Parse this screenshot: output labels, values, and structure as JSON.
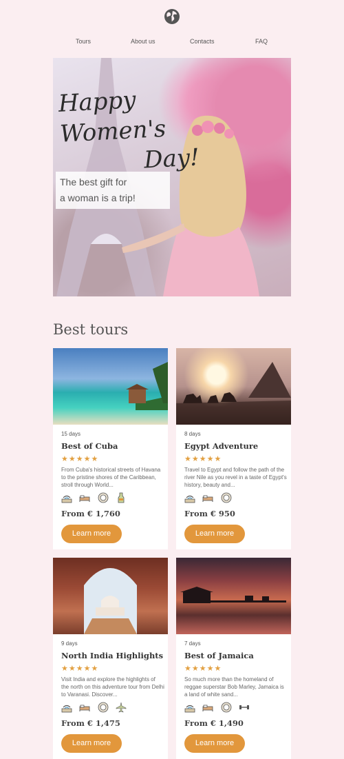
{
  "header": {
    "logo_icon": "globe-icon",
    "nav": [
      "Tours",
      "About us",
      "Contacts",
      "FAQ"
    ]
  },
  "hero": {
    "title_line1": "Happy Women's",
    "title_line2": "Day!",
    "caption_line1": "The best gift for",
    "caption_line2": "a woman is a trip!"
  },
  "section_title": "Best tours",
  "tours": [
    {
      "days": "15 days",
      "name": "Best of Cuba",
      "stars": "★★★★★",
      "desc": "From Cuba's historical streets of Havana to the pristine shores of the Caribbean, stroll through World...",
      "icons": [
        "wifi-icon",
        "bed-icon",
        "meal-icon",
        "drink-icon"
      ],
      "price": "From € 1,760",
      "button": "Learn more"
    },
    {
      "days": "8 days",
      "name": "Egypt Adventure",
      "stars": "★★★★★",
      "desc": "Travel to Egypt and follow the path of the river Nile as you revel in a taste of Egypt's history, beauty and...",
      "icons": [
        "wifi-icon",
        "bed-icon",
        "meal-icon"
      ],
      "price": "From € 950",
      "button": "Learn more"
    },
    {
      "days": "9 days",
      "name": "North India Highlights",
      "stars": "★★★★★",
      "desc": "Visit India and explore the highlights of the north on this adventure tour from Delhi to Varanasi. Discover...",
      "icons": [
        "wifi-icon",
        "bed-icon",
        "meal-icon",
        "plane-icon"
      ],
      "price": "From € 1,475",
      "button": "Learn more"
    },
    {
      "days": "7 days",
      "name": "Best of Jamaica",
      "stars": "★★★★★",
      "desc": "So much more than the homeland of reggae superstar Bob Marley, Jamaica is a land of white sand...",
      "icons": [
        "wifi-icon",
        "bed-icon",
        "meal-icon",
        "gym-icon"
      ],
      "price": "From € 1,490",
      "button": "Learn more"
    }
  ],
  "colors": {
    "background": "#fbeef1",
    "accent": "#e2973c",
    "stars": "#e2a041"
  }
}
